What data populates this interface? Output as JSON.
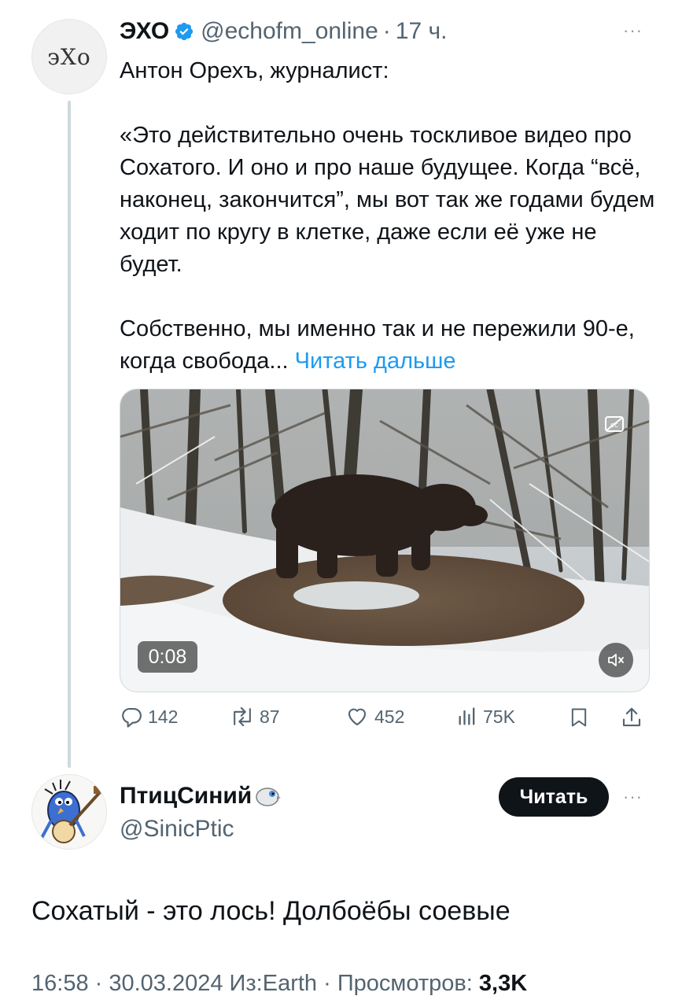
{
  "quoted_tweet": {
    "avatar_text": "эХо",
    "name": "ЭХО",
    "verified_icon": "verified-badge-icon",
    "handle": "@echofm_online",
    "separator": "·",
    "time": "17 ч.",
    "more": "···",
    "text": {
      "line_intro": "Антон Орехъ, журналист:",
      "paragraph_1": "«Это действительно очень тоскливое видео про Сохатого. И оно и про наше будущее. Когда “всё, наконец, закончится”, мы вот так же годами будем ходит по кругу в клетке, даже если её уже не будет.",
      "paragraph_2": "Собственно, мы именно так и не пережили 90-е, когда свобода...",
      "read_more": "Читать дальше"
    },
    "media": {
      "duration": "0:08",
      "captions_icon": "captions-icon",
      "mute_icon": "speaker-muted-icon"
    },
    "actions": {
      "replies": "142",
      "reposts": "87",
      "likes": "452",
      "views": "75K"
    }
  },
  "reply_tweet": {
    "name": "ПтицСиний",
    "name_emoji": "bird-emoji-icon",
    "handle": "@SinicPtic",
    "follow_label": "Читать",
    "more": "···",
    "text": "Сохатый - это лось! Долбоёбы соевые",
    "meta": {
      "time_date_source": "16:58 · 30.03.2024 Из:Earth · Просмотров: ",
      "views": "3,3K"
    }
  },
  "colors": {
    "text": "#0f1419",
    "secondary": "#536471",
    "link": "#1d9bf0",
    "verified": "#1d9bf0",
    "thread_line": "#cfd9de"
  }
}
